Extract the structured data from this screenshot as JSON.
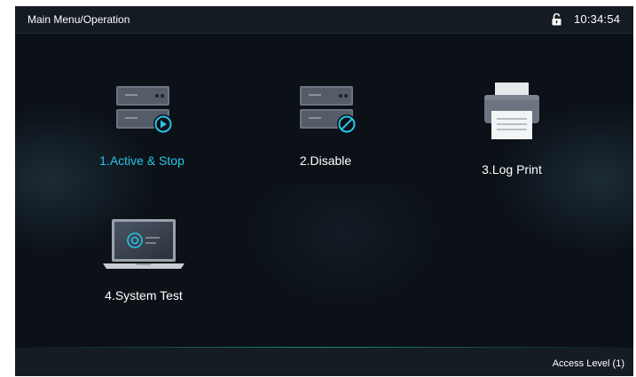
{
  "header": {
    "title": "Main Menu/Operation",
    "time": "10:34:54",
    "lock_icon": "unlocked-padlock-icon"
  },
  "menu": {
    "items": [
      {
        "label": "1.Active & Stop",
        "icon": "server-play-icon",
        "selected": true
      },
      {
        "label": "2.Disable",
        "icon": "server-disable-icon",
        "selected": false
      },
      {
        "label": "3.Log Print",
        "icon": "printer-icon",
        "selected": false
      },
      {
        "label": "4.System Test",
        "icon": "laptop-test-icon",
        "selected": false
      }
    ]
  },
  "footer": {
    "access_level": "Access Level  (1)"
  },
  "colors": {
    "background": "#0b1117",
    "selected_text": "#27c4e6",
    "accent": "#27c4e6"
  }
}
